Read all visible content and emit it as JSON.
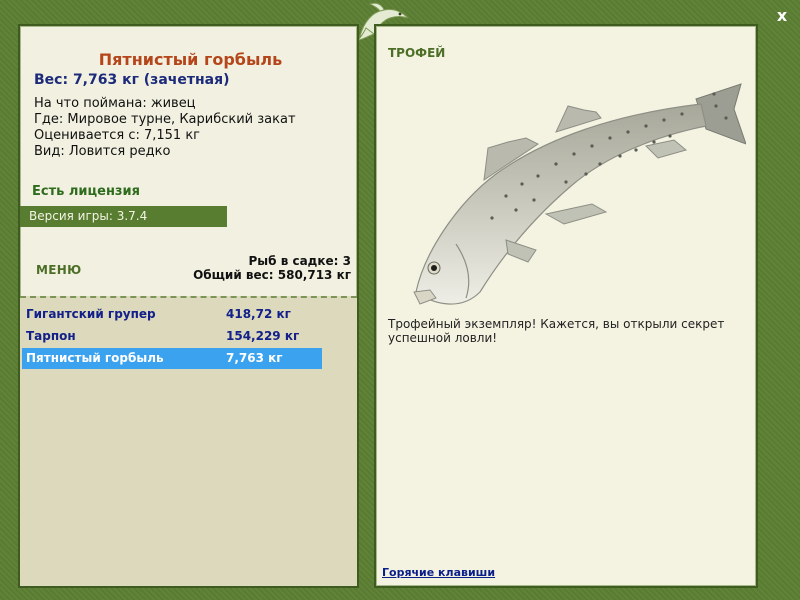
{
  "window": {
    "close_glyph": "x"
  },
  "fish": {
    "name": "Пятнистый горбыль",
    "weight_line": "Вес: 7,763 кг (зачетная)",
    "bait": "На что поймана: живец",
    "location": "Где: Мировое турне, Карибский закат",
    "rated_from": "Оценивается с: 7,151 кг",
    "kind": "Вид: Ловится редко"
  },
  "license": "Есть лицензия",
  "version": "Версия игры: 3.7.4",
  "menu_label": "МЕНЮ",
  "cage": {
    "count_line": "Рыб в садке: 3",
    "total_line": "Общий вес: 580,713 кг"
  },
  "catches": [
    {
      "name": "Гигантский групер",
      "weight": "418,72 кг",
      "selected": false
    },
    {
      "name": "Тарпон",
      "weight": "154,229 кг",
      "selected": false
    },
    {
      "name": "Пятнистый горбыль",
      "weight": "7,763 кг",
      "selected": true
    }
  ],
  "trophy": {
    "label": "ТРОФЕЙ",
    "text": "Трофейный экземпляр! Кажется, вы открыли секрет успешной ловли!",
    "hotkeys": "Горячие клавиши"
  },
  "icons": {
    "logo": "leaping-fish-logo-icon",
    "close": "close-icon",
    "fish_picture": "spotted-seatrout-image"
  },
  "colors": {
    "frame": "#5c7f33",
    "panel": "#f2f1e1",
    "list_bg": "#dcd9bd",
    "title": "#b5451a",
    "weight": "#1c2a7a",
    "accent_green": "#4c6e26",
    "selection": "#3aa2ee",
    "link": "#0a1e8a"
  }
}
